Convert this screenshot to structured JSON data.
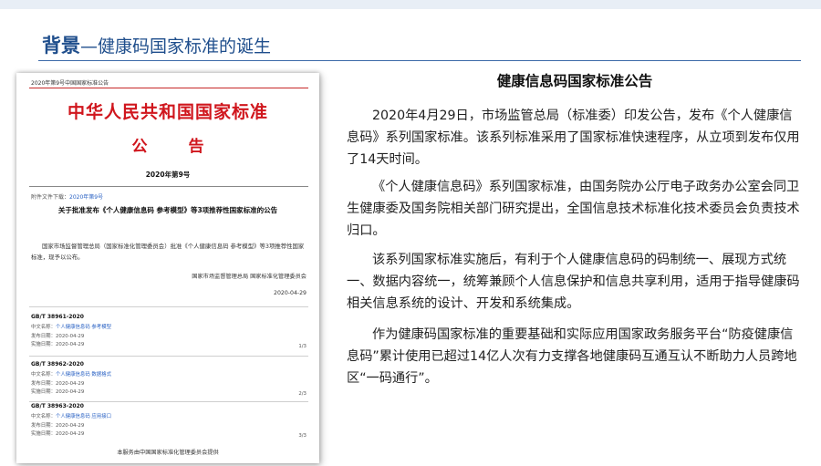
{
  "header": {
    "title_lead": "背景",
    "title_rest": "—健康码国家标准的诞生"
  },
  "document": {
    "issue": "2020年第9号中国国家标准公告",
    "heading": "中华人民共和国国家标准",
    "subheading": "公　告",
    "number": "2020年第9号",
    "attach_label": "附件文件下载：",
    "attach_link": "2020年第9号",
    "notice_title": "关于批准发布《个人健康信息码 参考模型》等3项推荐性国家标准的公告",
    "notice_body": "国家市场监督管理总局（国家标准化管理委员会）批准《个人健康信息码 参考模型》等3项推荐性国家标准，现予以公布。",
    "issuer": "国家市场监督管理总局 国家标准化管理委员会",
    "date": "2020-04-29",
    "standards": [
      {
        "code": "GB/T 38961-2020",
        "name_label": "中文名称：",
        "name": "个人健康信息码 参考模型",
        "pub_label": "发布日期：",
        "pub": "2020-04-29",
        "impl_label": "实施日期：",
        "impl": "2020-04-29",
        "page": "1/3"
      },
      {
        "code": "GB/T 38962-2020",
        "name_label": "中文名称：",
        "name": "个人健康信息码 数据格式",
        "pub_label": "发布日期：",
        "pub": "2020-04-29",
        "impl_label": "实施日期：",
        "impl": "2020-04-29",
        "page": "2/3"
      },
      {
        "code": "GB/T 38963-2020",
        "name_label": "中文名称：",
        "name": "个人健康信息码 应用接口",
        "pub_label": "发布日期：",
        "pub": "2020-04-29",
        "impl_label": "实施日期：",
        "impl": "2020-04-29",
        "page": "3/3"
      }
    ],
    "footer": "本服务由中国国家标准化管理委员会提供"
  },
  "panel": {
    "title": "健康信息码国家标准公告",
    "paragraphs": [
      "2020年4月29日，市场监管总局（标准委）印发公告，发布《个人健康信息码》系列国家标准。该系列标准采用了国家标准快速程序，从立项到发布仅用了14天时间。",
      "《个人健康信息码》系列国家标准，由国务院办公厅电子政务办公室会同卫生健康委及国务院相关部门研究提出，全国信息技术标准化技术委员会负责技术归口。",
      "该系列国家标准实施后，有利于个人健康信息码的码制统一、展现方式统一、数据内容统一，统筹兼顾个人信息保护和信息共享利用，适用于指导健康码相关信息系统的设计、开发和系统集成。",
      "作为健康码国家标准的重要基础和实际应用国家政务服务平台“防疫健康信息码”累计使用已超过14亿人次有力支撑各地健康码互通互认不断助力人员跨地区“一码通行”。"
    ]
  },
  "colors": {
    "brand_blue": "#1f4e8c",
    "red": "#d0161d",
    "link": "#2a62c4"
  }
}
